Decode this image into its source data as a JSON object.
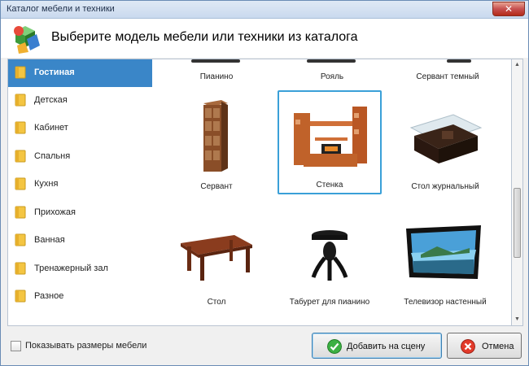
{
  "window": {
    "title": "Каталог мебели и техники"
  },
  "header": {
    "title": "Выберите модель мебели или техники из каталога"
  },
  "sidebar": {
    "items": [
      {
        "label": "Гостиная",
        "active": true
      },
      {
        "label": "Детская"
      },
      {
        "label": "Кабинет"
      },
      {
        "label": "Спальня"
      },
      {
        "label": "Кухня"
      },
      {
        "label": "Прихожая"
      },
      {
        "label": "Ванная"
      },
      {
        "label": "Тренажерный зал"
      },
      {
        "label": "Разное"
      }
    ]
  },
  "catalog": {
    "top_row": [
      "Пианино",
      "Рояль",
      "Сервант темный"
    ],
    "items": [
      {
        "label": "Сервант",
        "icon": "cabinet-icon"
      },
      {
        "label": "Стенка",
        "icon": "wall-unit-icon",
        "selected": true
      },
      {
        "label": "Стол журнальный",
        "icon": "coffee-table-icon"
      },
      {
        "label": "Стол",
        "icon": "table-icon"
      },
      {
        "label": "Табурет для пианино",
        "icon": "piano-stool-icon"
      },
      {
        "label": "Телевизор настенный",
        "icon": "wall-tv-icon"
      }
    ]
  },
  "footer": {
    "show_sizes_label": "Показывать размеры мебели",
    "add_button": "Добавить на сцену",
    "cancel_button": "Отмена"
  },
  "colors": {
    "accent": "#3a86c8",
    "selection": "#3aa0d8"
  }
}
